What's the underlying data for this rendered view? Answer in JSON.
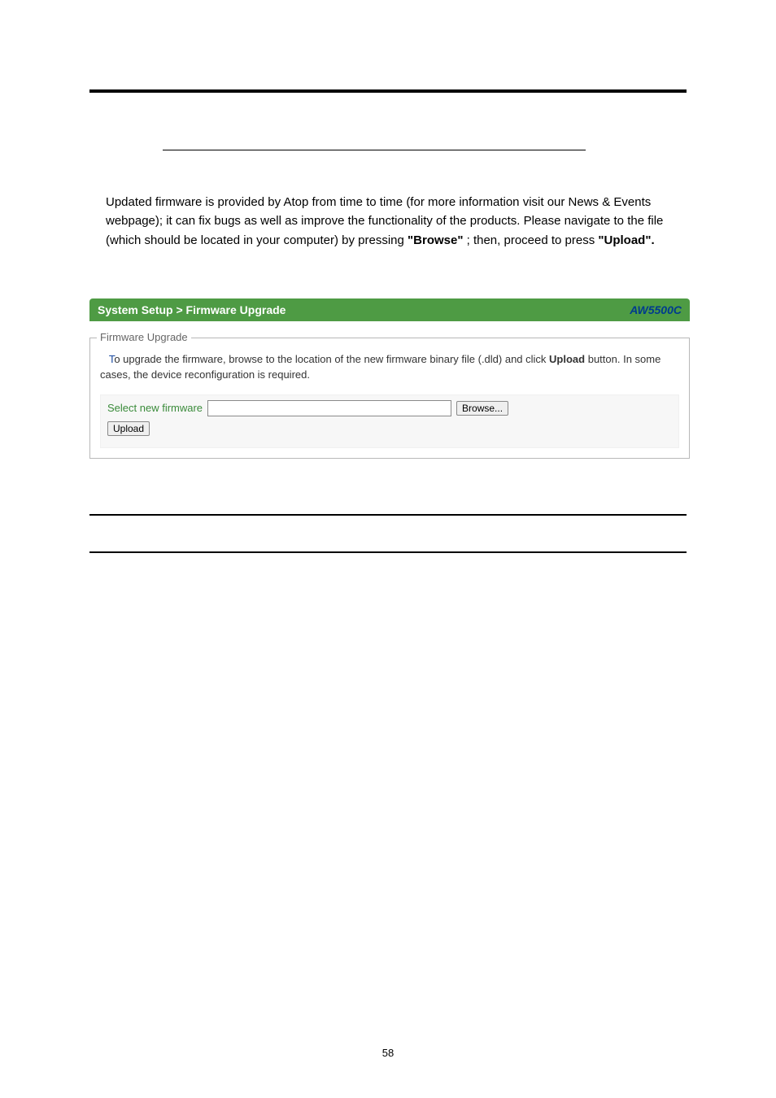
{
  "body": {
    "para1_a": "Updated firmware is provided by Atop from time to time (for more information visit our News & Events webpage); it can fix bugs as well as improve the functionality of the products. Please navigate to the file (which should be located in your computer) by pressing ",
    "browse": "\"Browse\"",
    "para1_b": "; then, proceed to press ",
    "upload": "\"Upload\"."
  },
  "panel": {
    "title": "System Setup > Firmware Upgrade",
    "model": "AW5500C"
  },
  "fieldset": {
    "legend": "Firmware Upgrade",
    "instr_first": "T",
    "instr_rest_a": "o upgrade the firmware, browse to the location of the new firmware binary file (.dld) and click ",
    "instr_bold": "Upload",
    "instr_rest_b": " button. In some cases, the device reconfiguration is required.",
    "select_label": "Select new firmware",
    "browse_btn": "Browse...",
    "upload_btn": "Upload"
  },
  "page_number": "58"
}
